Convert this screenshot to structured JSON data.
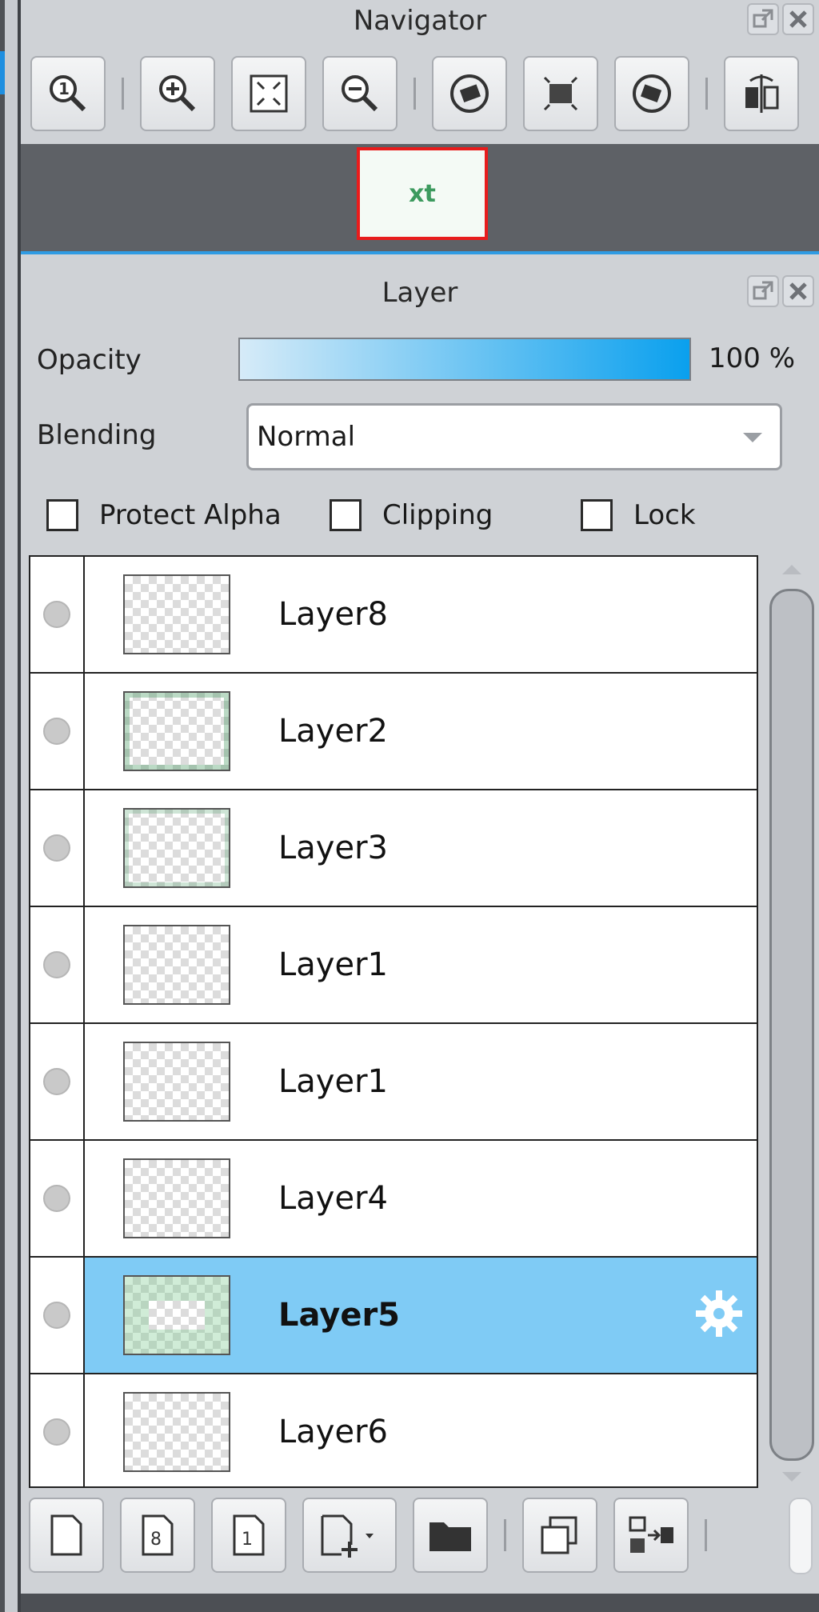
{
  "navigator": {
    "title": "Navigator",
    "tools": [
      "zoom-actual-icon",
      "zoom-in-icon",
      "fit-screen-icon",
      "zoom-out-icon",
      "rotate-left-icon",
      "reset-view-icon",
      "rotate-right-icon",
      "flip-horizontal-icon"
    ],
    "preview_text": "xt"
  },
  "layer_panel": {
    "title": "Layer",
    "opacity_label": "Opacity",
    "opacity_value": "100 %",
    "opacity_fraction": 1.0,
    "blending_label": "Blending",
    "blending_value": "Normal",
    "protect_alpha_label": "Protect Alpha",
    "clipping_label": "Clipping",
    "lock_label": "Lock",
    "layers": [
      {
        "name": "Layer8",
        "selected": false
      },
      {
        "name": "Layer2",
        "selected": false
      },
      {
        "name": "Layer3",
        "selected": false
      },
      {
        "name": "Layer1",
        "selected": false
      },
      {
        "name": "Layer1",
        "selected": false
      },
      {
        "name": "Layer4",
        "selected": false
      },
      {
        "name": "Layer5",
        "selected": true
      },
      {
        "name": "Layer6",
        "selected": false
      }
    ],
    "bottom_tools": [
      "new-layer-icon",
      "new-8bit-layer-icon",
      "new-1bit-layer-icon",
      "add-layer-menu-icon",
      "new-folder-icon",
      "duplicate-layer-icon",
      "transfer-layer-icon"
    ],
    "colors": {
      "selected": "#7fcbf5",
      "accent": "#2f9be3",
      "nav_frame": "#e81c1c"
    }
  }
}
